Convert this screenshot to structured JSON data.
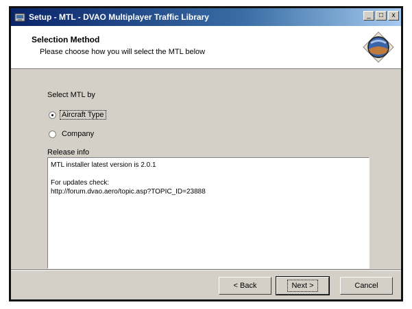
{
  "window": {
    "title": "Setup - MTL - DVAO Multiplayer Traffic Library",
    "minimize": "_",
    "maximize": "□",
    "close": "x"
  },
  "header": {
    "title": "Selection Method",
    "subtitle": "Please choose how you will select the MTL below"
  },
  "content": {
    "select_label": "Select MTL by",
    "options": [
      {
        "label": "Aircraft Type",
        "checked": true
      },
      {
        "label": "Company",
        "checked": false
      }
    ],
    "release_label": "Release info",
    "release_lines": [
      "MTL installer latest version is 2.0.1",
      "For updates check:",
      "http://forum.dvao.aero/topic.asp?TOPIC_ID=23888"
    ]
  },
  "buttons": {
    "back": "< Back",
    "next": "Next >",
    "cancel": "Cancel"
  },
  "colors": {
    "title_gradient_start": "#0a246a",
    "title_gradient_end": "#a6caf0",
    "dialog_face": "#d4d0c8"
  }
}
